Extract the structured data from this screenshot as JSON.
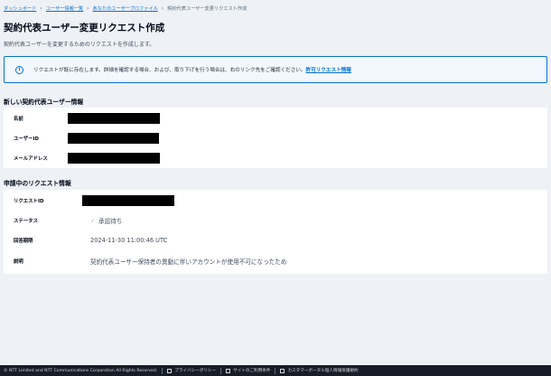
{
  "breadcrumb": {
    "items": [
      "ダッシュボード",
      "ユーザー情報一覧",
      "あなたのユーザープロファイル"
    ],
    "current": "契約代表ユーザー変更リクエスト作成"
  },
  "page": {
    "title": "契約代表ユーザー変更リクエスト作成",
    "subtitle": "契約代表ユーザーを変更するためのリクエストを作成します。"
  },
  "alert": {
    "icon": "info-icon",
    "message": "リクエストが既に存在します。詳細を確認する場合、および、取り下げを行う場合は、右のリンク先をご確認ください。",
    "link_label": "許可リクエスト情報"
  },
  "new_user": {
    "header": "新しい契約代表ユーザー情報",
    "fields": [
      {
        "label": "名前"
      },
      {
        "label": "ユーザーID"
      },
      {
        "label": "メールアドレス"
      }
    ]
  },
  "request": {
    "header": "申請中のリクエスト情報",
    "fields": [
      {
        "label": "リクエストID",
        "value": ""
      },
      {
        "label": "ステータス",
        "value": "承認待ち"
      },
      {
        "label": "回答期限",
        "value": "2024-11-30 11:00:46 UTC"
      },
      {
        "label": "説明",
        "value": "契約代表ユーザー保持者の異動に伴いアカウントが使用不可になったため"
      }
    ]
  },
  "footer": {
    "copyright": "© NTT Limited and NTT Communications Corporation All Rights Reserved.",
    "links": [
      "プライバシーポリシー",
      "サイトのご利用条件",
      "カスタマーポータル個人情報保護規約"
    ]
  },
  "colors": {
    "accent": "#0972d3",
    "background": "#eef1f6",
    "footer": "#161d26"
  }
}
